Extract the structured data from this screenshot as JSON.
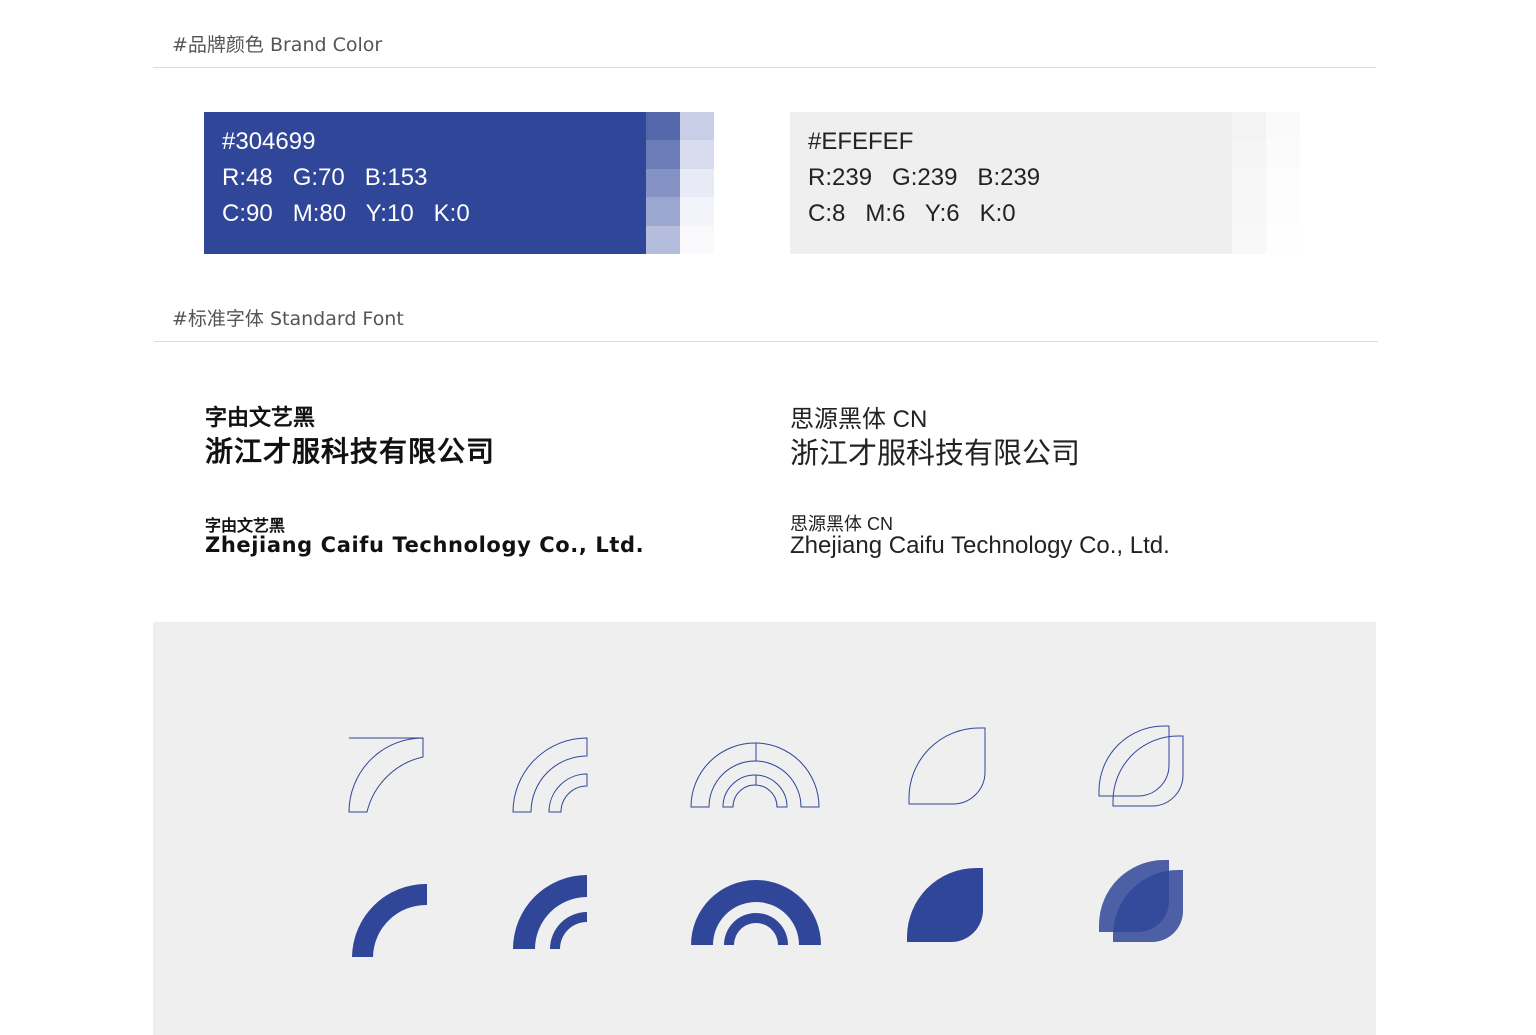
{
  "brand_section": {
    "title": "#品牌颜色  Brand Color"
  },
  "font_section": {
    "title": "#标准字体  Standard Font"
  },
  "colors": [
    {
      "hex": "#304699",
      "rgb": "R:48   G:70   B:153",
      "cmyk": "C:90   M:80   Y:10   K:0",
      "swatch_color": "#304699",
      "text_color": "#ffffff",
      "tints": [
        "#5467ab",
        "#6c7cb7",
        "#8492c4",
        "#9ca7d0",
        "#b4bddc",
        "#c8cee6",
        "#d8dcee",
        "#e8eaf5",
        "#f3f4fa",
        "#f9f9fc"
      ]
    },
    {
      "hex": "#EFEFEF",
      "rgb": "R:239   G:239   B:239",
      "cmyk": "C:8   M:6   Y:6   K:0",
      "swatch_color": "#efefef",
      "text_color": "#222222",
      "tints": [
        "#f3f3f3",
        "#f5f5f5",
        "#f6f6f6",
        "#f7f7f7",
        "#f8f8f8",
        "#fafafa",
        "#fbfbfb",
        "#fcfcfc",
        "#fdfdfd",
        "#fefefe"
      ]
    }
  ],
  "fonts": {
    "heavy_name": "字由文艺黑",
    "heavy_cn_sample": "浙江才服科技有限公司",
    "heavy_en_name": "字由文艺黑",
    "heavy_en_sample": "Zhejiang Caifu Technology Co., Ltd.",
    "light_name": "思源黑体 CN",
    "light_cn_sample": "浙江才服科技有限公司",
    "light_en_name": "思源黑体 CN",
    "light_en_sample": "Zhejiang Caifu Technology Co., Ltd."
  },
  "icon_colors": {
    "stroke": "#304699",
    "fill": "#304699"
  },
  "icons": [
    {
      "name": "quarter-arc",
      "style": "outline"
    },
    {
      "name": "double-quarter-arc",
      "style": "outline"
    },
    {
      "name": "double-semicircle-arch",
      "style": "outline"
    },
    {
      "name": "leaf-shape",
      "style": "outline"
    },
    {
      "name": "overlapping-leaf-shapes",
      "style": "outline"
    },
    {
      "name": "quarter-arc",
      "style": "filled"
    },
    {
      "name": "double-quarter-arc",
      "style": "filled"
    },
    {
      "name": "double-semicircle-arch",
      "style": "filled"
    },
    {
      "name": "leaf-shape",
      "style": "filled"
    },
    {
      "name": "overlapping-leaf-shapes",
      "style": "filled"
    }
  ]
}
